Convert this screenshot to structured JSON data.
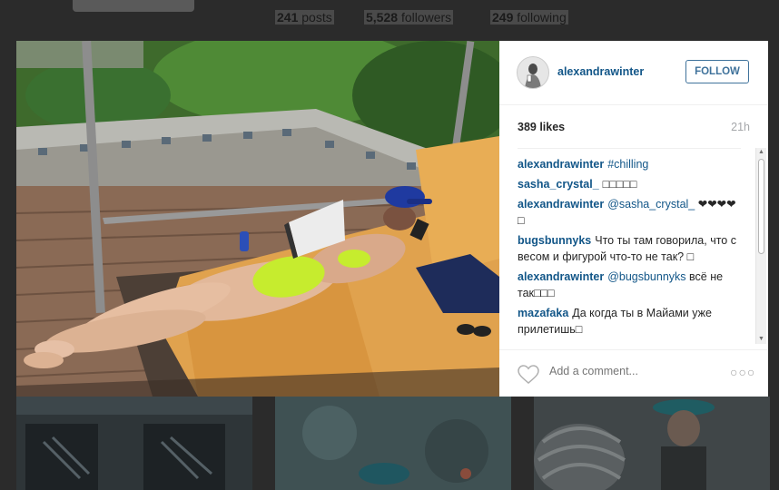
{
  "profile": {
    "posts_count": "241",
    "posts_label": "posts",
    "followers_count": "5,528",
    "followers_label": "followers",
    "following_count": "249",
    "following_label": "following"
  },
  "post": {
    "username": "alexandrawinter",
    "follow_label": "FOLLOW",
    "likes": "389 likes",
    "time_ago": "21h",
    "add_comment_placeholder": "Add a comment...",
    "more_label": "○○○",
    "comments": [
      {
        "author": "alexandrawinter",
        "text": "#chilling",
        "mention": true
      },
      {
        "author": "sasha_crystal_",
        "text": "□□□□□",
        "mention": false
      },
      {
        "author": "alexandrawinter",
        "text": "@sasha_crystal_ ❤❤❤❤□",
        "mention": true
      },
      {
        "author": "bugsbunnyks",
        "text": "Что ты там говорила, что с весом и фигурой что-то не так? □",
        "mention": false
      },
      {
        "author": "alexandrawinter",
        "text": "@bugsbunnyks всё не так□□□",
        "mention": true
      },
      {
        "author": "mazafaka",
        "text": "Да когда ты в Майами уже прилетишь□",
        "mention": false
      }
    ]
  },
  "colors": {
    "link_blue": "#125688",
    "follow_blue": "#3f729b",
    "backdrop": "#2b2b2b"
  },
  "icons": {
    "heart": "heart-outline-icon",
    "more": "ellipsis-icon",
    "scroll_up": "triangle-up-icon",
    "scroll_down": "triangle-down-icon"
  }
}
